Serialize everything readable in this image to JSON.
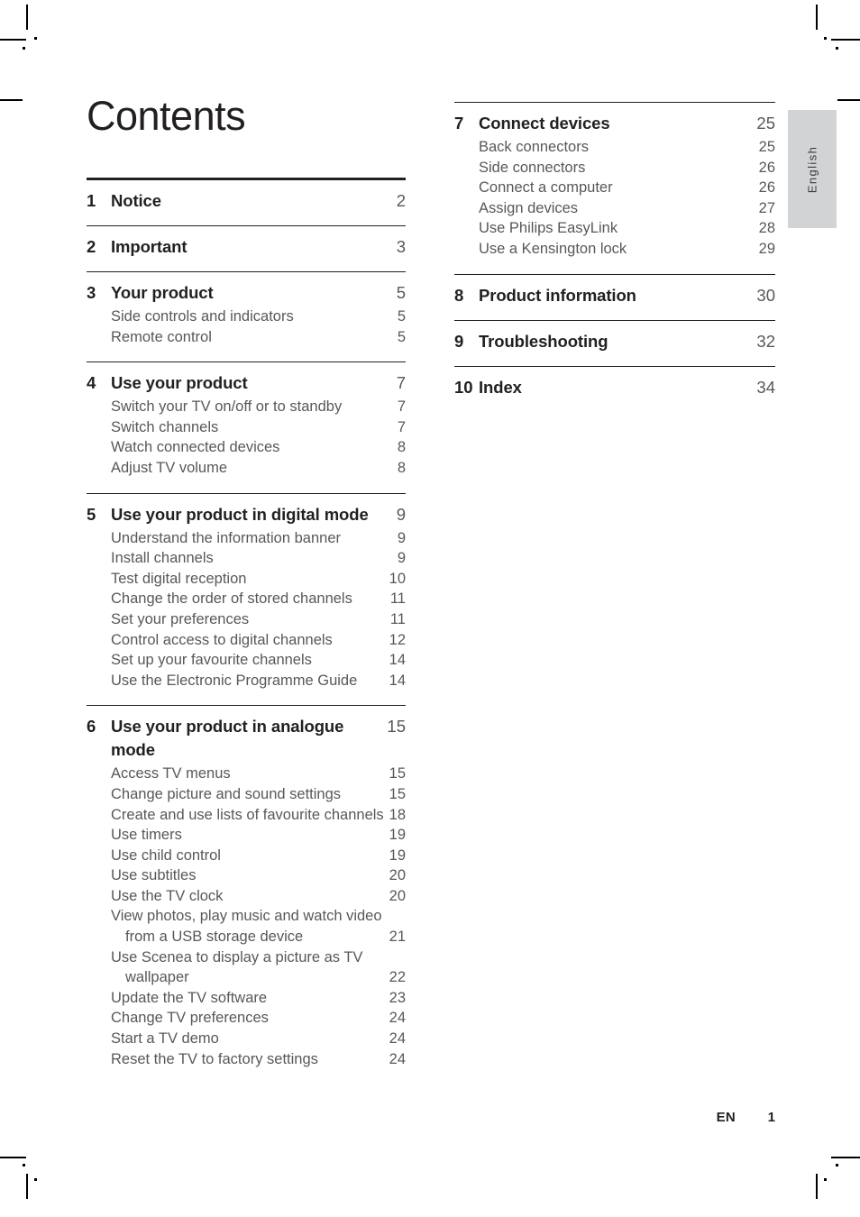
{
  "page": {
    "title": "Contents",
    "side_tab_label": "English",
    "footer_language": "EN",
    "footer_page_number": "1",
    "text_color": "#231f20",
    "muted_color": "#58585a",
    "tab_background": "#d2d3d5"
  },
  "left_column": [
    {
      "rule": "thick",
      "number": "1",
      "title": "Notice",
      "page": "2",
      "subentries": []
    },
    {
      "rule": "thin",
      "number": "2",
      "title": "Important",
      "page": "3",
      "subentries": []
    },
    {
      "rule": "thin",
      "number": "3",
      "title": "Your product",
      "page": "5",
      "subentries": [
        {
          "title": "Side controls and indicators",
          "page": "5"
        },
        {
          "title": "Remote control",
          "page": "5"
        }
      ]
    },
    {
      "rule": "thin",
      "number": "4",
      "title": "Use your product",
      "page": "7",
      "subentries": [
        {
          "title": "Switch your TV on/off or to standby",
          "page": "7"
        },
        {
          "title": "Switch channels",
          "page": "7"
        },
        {
          "title": "Watch connected devices",
          "page": "8"
        },
        {
          "title": "Adjust TV volume",
          "page": "8"
        }
      ]
    },
    {
      "rule": "thin",
      "number": "5",
      "title": "Use your product in digital mode",
      "page": "9",
      "subentries": [
        {
          "title": "Understand the information banner",
          "page": "9"
        },
        {
          "title": "Install channels",
          "page": "9"
        },
        {
          "title": "Test digital reception",
          "page": "10"
        },
        {
          "title": "Change the order of stored channels",
          "page": "11"
        },
        {
          "title": "Set your preferences",
          "page": "11"
        },
        {
          "title": "Control access to digital channels",
          "page": "12"
        },
        {
          "title": "Set up your favourite channels",
          "page": "14"
        },
        {
          "title": "Use the Electronic Programme Guide",
          "page": "14"
        }
      ]
    },
    {
      "rule": "thin",
      "number": "6",
      "title": "Use your product in analogue mode",
      "page": "15",
      "subentries": [
        {
          "title": "Access TV menus",
          "page": "15"
        },
        {
          "title": "Change picture and sound settings",
          "page": "15"
        },
        {
          "title": "Create and use lists of favourite channels",
          "page": "18"
        },
        {
          "title": "Use timers",
          "page": "19"
        },
        {
          "title": "Use child control",
          "page": "19"
        },
        {
          "title": "Use subtitles",
          "page": "20"
        },
        {
          "title": "Use the TV clock",
          "page": "20"
        },
        {
          "title": "View photos, play music and watch video",
          "page": "",
          "continuation": "from a USB storage device",
          "continuation_page": "21"
        },
        {
          "title": "Use Scenea to display a picture as TV",
          "page": "",
          "continuation": "wallpaper",
          "continuation_page": "22"
        },
        {
          "title": "Update the TV software",
          "page": "23"
        },
        {
          "title": "Change TV preferences",
          "page": "24"
        },
        {
          "title": "Start a TV demo",
          "page": "24"
        },
        {
          "title": "Reset the TV to factory settings",
          "page": "24"
        }
      ]
    }
  ],
  "right_column": [
    {
      "rule": "thin",
      "number": "7",
      "title": "Connect devices",
      "page": "25",
      "subentries": [
        {
          "title": "Back connectors",
          "page": "25"
        },
        {
          "title": "Side connectors",
          "page": "26"
        },
        {
          "title": "Connect a computer",
          "page": "26"
        },
        {
          "title": "Assign devices",
          "page": "27"
        },
        {
          "title": "Use Philips EasyLink",
          "page": "28"
        },
        {
          "title": "Use a Kensington lock",
          "page": "29"
        }
      ]
    },
    {
      "rule": "thin",
      "number": "8",
      "title": "Product information",
      "page": "30",
      "subentries": []
    },
    {
      "rule": "thin",
      "number": "9",
      "title": "Troubleshooting",
      "page": "32",
      "subentries": []
    },
    {
      "rule": "thin",
      "number": "10",
      "title": "Index",
      "page": "34",
      "subentries": []
    }
  ]
}
